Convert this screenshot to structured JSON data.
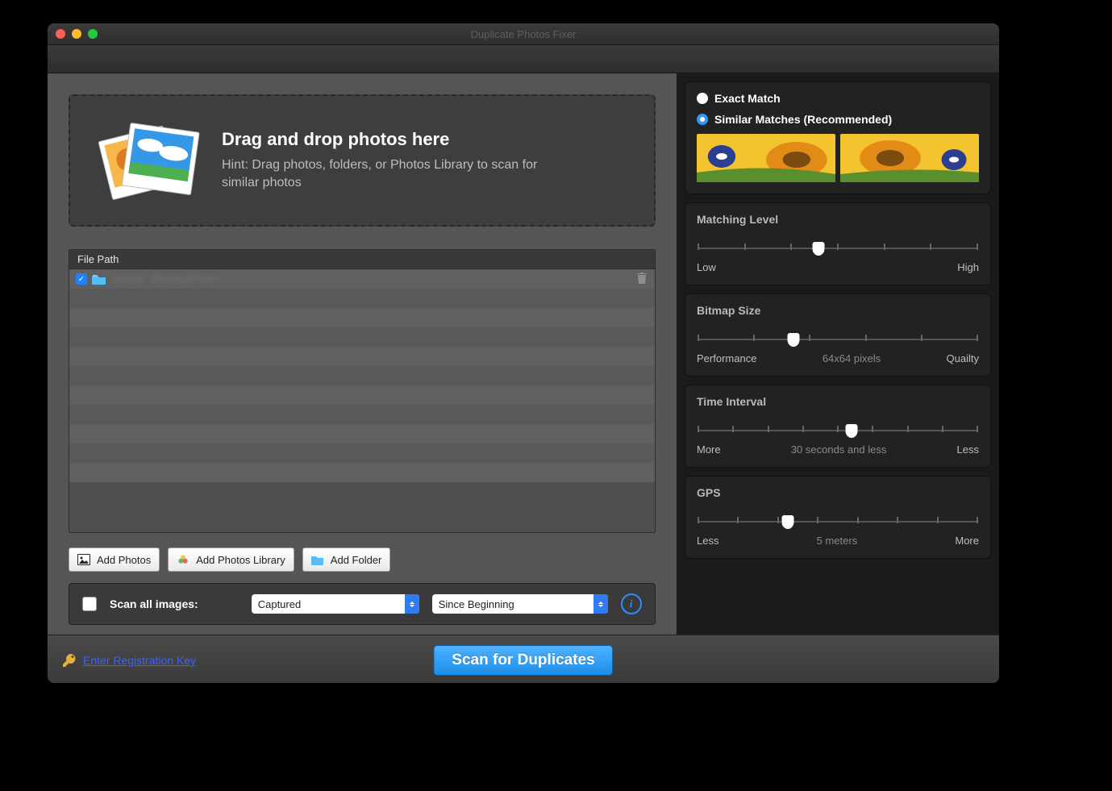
{
  "window": {
    "title": "Duplicate Photos Fixer"
  },
  "traffic": {
    "close": "#ff5f57",
    "min": "#febc2e",
    "max": "#28c840"
  },
  "drop": {
    "heading": "Drag and drop photos here",
    "hint": "Hint: Drag photos, folders, or Photos Library to scan for similar photos"
  },
  "list": {
    "header": "File Path",
    "rows": [
      {
        "checked": true,
        "path": "/Users/.../Desktop/Finurn"
      }
    ]
  },
  "addButtons": {
    "photos": "Add Photos",
    "library": "Add Photos Library",
    "folder": "Add Folder"
  },
  "scanbar": {
    "checkboxLabel": "Scan all images:",
    "select1": "Captured",
    "select2": "Since Beginning"
  },
  "match": {
    "exact": "Exact Match",
    "similar": "Similar Matches (Recommended)"
  },
  "sliders": {
    "matching": {
      "title": "Matching Level",
      "left": "Low",
      "right": "High",
      "pos": 43,
      "ticks": 7
    },
    "bitmap": {
      "title": "Bitmap Size",
      "left": "Performance",
      "mid": "64x64 pixels",
      "right": "Quailty",
      "pos": 34,
      "ticks": 6
    },
    "time": {
      "title": "Time Interval",
      "left": "More",
      "mid": "30 seconds and less",
      "right": "Less",
      "pos": 55,
      "ticks": 9
    },
    "gps": {
      "title": "GPS",
      "left": "Less",
      "mid": "5 meters",
      "right": "More",
      "pos": 32,
      "ticks": 8
    }
  },
  "footer": {
    "regKey": "Enter Registration Key",
    "scan": "Scan for Duplicates"
  }
}
